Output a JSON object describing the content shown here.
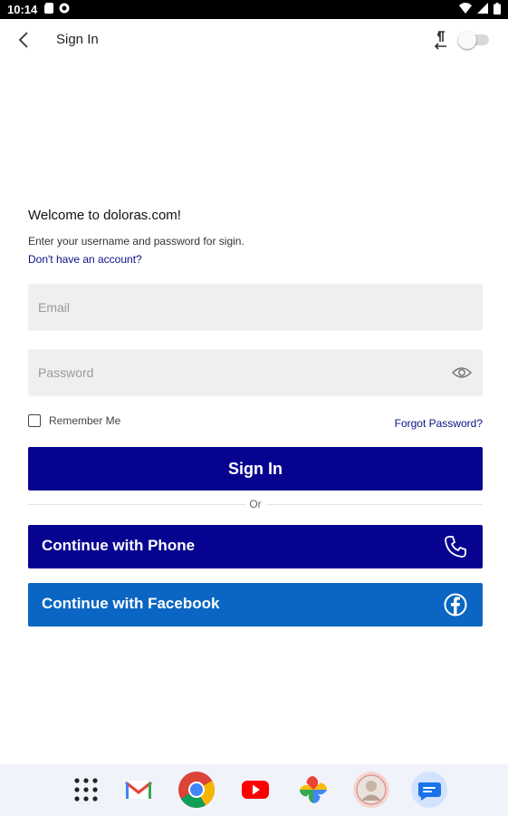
{
  "status_bar": {
    "time": "10:14"
  },
  "app_bar": {
    "title": "Sign In"
  },
  "form": {
    "welcome": "Welcome to doloras.com!",
    "instruction": "Enter your username and password for sigin.",
    "signup_link": "Don't have an account?",
    "email": {
      "placeholder": "Email",
      "value": ""
    },
    "password": {
      "placeholder": "Password",
      "value": ""
    },
    "remember_me": {
      "label": "Remember Me",
      "checked": false
    },
    "forgot_password": "Forgot Password?",
    "signin_button": "Sign In",
    "divider_text": "Or",
    "phone_button": "Continue with Phone",
    "facebook_button": "Continue with Facebook"
  },
  "colors": {
    "primary": "#060390",
    "facebook": "#0a66c2",
    "link": "#0b1187",
    "field_bg": "#efefef"
  },
  "icons": {
    "back": "arrow-back-icon",
    "rtl": "text-direction-icon",
    "password_visibility": "eye-icon",
    "phone": "phone-icon",
    "facebook": "facebook-icon"
  },
  "dock": {
    "apps": [
      "app-drawer",
      "gmail",
      "chrome",
      "youtube",
      "photos",
      "contacts",
      "messages"
    ]
  }
}
